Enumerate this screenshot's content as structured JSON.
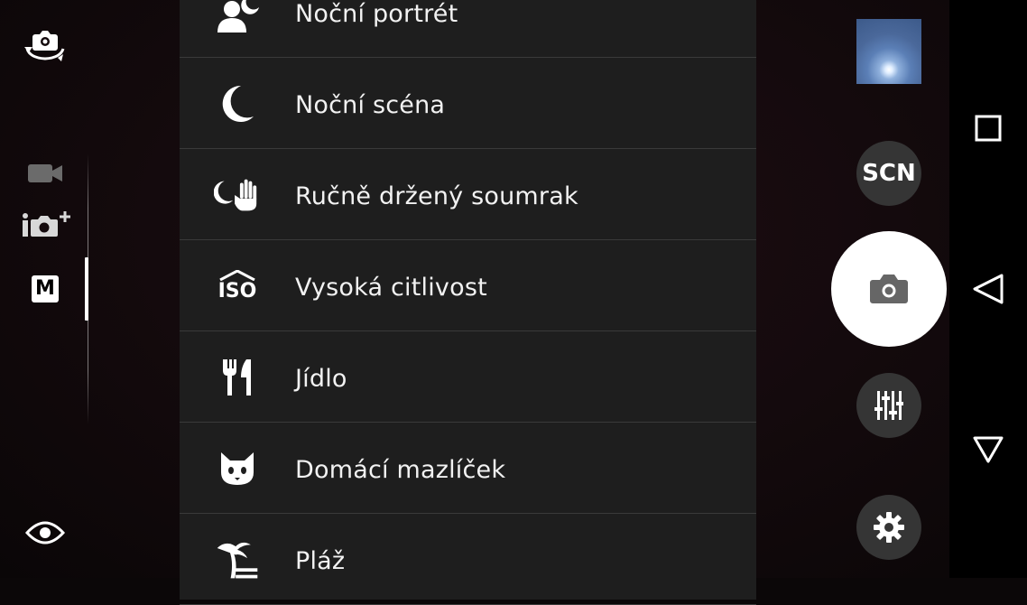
{
  "left_controls": {
    "switch_camera": "switch-camera-icon",
    "modes": [
      {
        "icon": "video-camera-icon"
      },
      {
        "icon": "superior-auto-camera-icon"
      },
      {
        "icon": "manual-mode-icon",
        "label": "M",
        "selected": true
      }
    ],
    "eye": "eye-icon"
  },
  "scenes": [
    {
      "label": "Noční portrét",
      "icon": "night-portrait-icon"
    },
    {
      "label": "Noční scéna",
      "icon": "moon-icon"
    },
    {
      "label": "Ručně držený soumrak",
      "icon": "handheld-twilight-icon"
    },
    {
      "label": "Vysoká citlivost",
      "icon": "high-iso-icon",
      "icon_text": "ISO"
    },
    {
      "label": "Jídlo",
      "icon": "fork-knife-icon"
    },
    {
      "label": "Domácí mazlíček",
      "icon": "cat-icon"
    },
    {
      "label": "Pláž",
      "icon": "palm-beach-icon"
    }
  ],
  "right_controls": {
    "scn_label": "SCN",
    "shutter_icon": "camera-icon",
    "tune_icon": "sliders-icon",
    "settings_icon": "gear-icon"
  },
  "navbar": {
    "recent": "square-icon",
    "back": "back-triangle-icon",
    "home": "home-triangle-icon"
  },
  "colors": {
    "list_bg": "#1e1e1e",
    "divider": "#3a3a3a",
    "button_bg": "#353535",
    "shutter_bg": "#ffffff"
  }
}
